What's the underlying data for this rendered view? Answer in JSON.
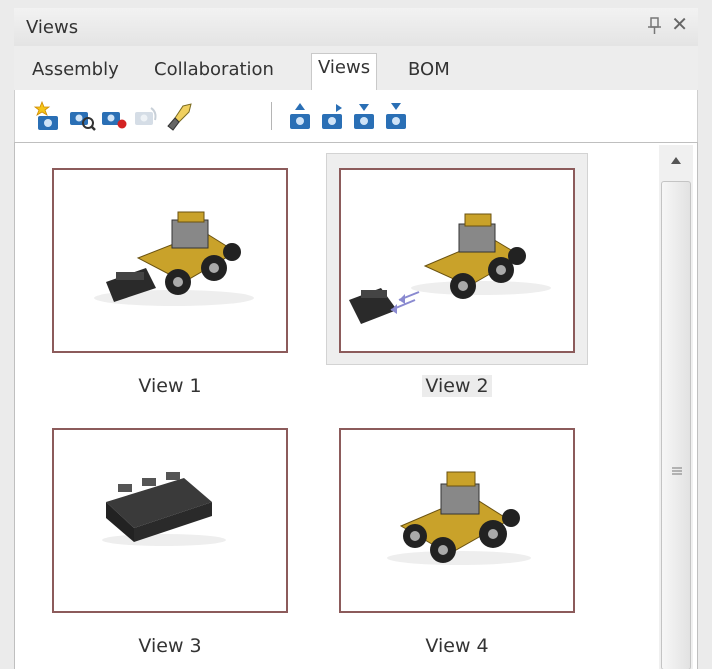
{
  "panel": {
    "title": "Views"
  },
  "tabs": [
    {
      "label": "Assembly",
      "active": false
    },
    {
      "label": "Collaboration",
      "active": false
    },
    {
      "label": "Views",
      "active": true
    },
    {
      "label": "BOM",
      "active": false
    }
  ],
  "toolbar": {
    "buttons": [
      {
        "icon": "new-view-icon"
      },
      {
        "icon": "update-view-icon"
      },
      {
        "icon": "delete-view-icon"
      },
      {
        "icon": "view-disabled-icon"
      },
      {
        "icon": "brush-icon"
      },
      {
        "icon": "move-first-icon"
      },
      {
        "icon": "move-up-icon"
      },
      {
        "icon": "move-down-icon"
      },
      {
        "icon": "move-last-icon"
      }
    ]
  },
  "views": [
    {
      "label": "View 1",
      "selected": false
    },
    {
      "label": "View 2",
      "selected": true
    },
    {
      "label": "View 3",
      "selected": false
    },
    {
      "label": "View 4",
      "selected": false
    }
  ],
  "colors": {
    "frame": "#8c5b5b",
    "accent": "#2a6fb5",
    "tractor": "#c9a22a"
  }
}
